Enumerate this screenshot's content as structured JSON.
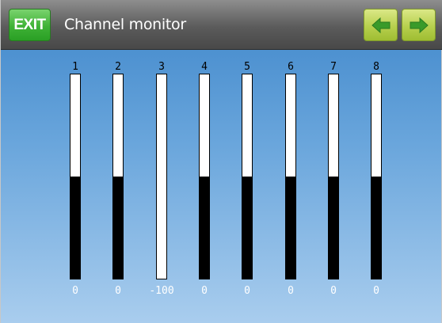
{
  "header": {
    "exit_label": "EXIT",
    "title": "Channel monitor",
    "prev_icon": "arrow-left-icon",
    "next_icon": "arrow-right-icon"
  },
  "channels": [
    {
      "number": "1",
      "value": "0",
      "fill_fraction": 0.5
    },
    {
      "number": "2",
      "value": "0",
      "fill_fraction": 0.5
    },
    {
      "number": "3",
      "value": "-100",
      "fill_fraction": 0.0
    },
    {
      "number": "4",
      "value": "0",
      "fill_fraction": 0.5
    },
    {
      "number": "5",
      "value": "0",
      "fill_fraction": 0.5
    },
    {
      "number": "6",
      "value": "0",
      "fill_fraction": 0.5
    },
    {
      "number": "7",
      "value": "0",
      "fill_fraction": 0.5
    },
    {
      "number": "8",
      "value": "0",
      "fill_fraction": 0.5
    }
  ],
  "colors": {
    "header": "#5b5b5b",
    "exit_button": "#3fb236",
    "arrow_button": "#b7d04e",
    "arrow_glyph": "#3a9a2a",
    "background_top": "#3e86ca",
    "background_bottom": "#a9cdee"
  }
}
